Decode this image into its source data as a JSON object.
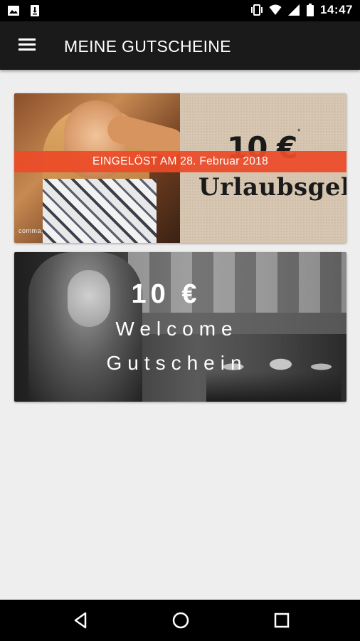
{
  "status_bar": {
    "time": "14:47",
    "left_icons": [
      "image-icon",
      "download-icon"
    ],
    "right_icons": [
      "vibrate-icon",
      "wifi-icon",
      "signal-icon",
      "battery-icon"
    ]
  },
  "app_bar": {
    "menu_icon": "menu-icon",
    "title": "MEINE GUTSCHEINE"
  },
  "vouchers": [
    {
      "amount": "10 €",
      "asterisk": "*",
      "name": "Urlaubsgeld",
      "brand": "comma,",
      "status": "EINGELÖST AM 28. Februar 2018",
      "status_color": "#ec4b28"
    },
    {
      "amount": "10 €",
      "line1": "Welcome",
      "line2": "Gutschein"
    }
  ],
  "nav_bar": {
    "buttons": [
      "back-icon",
      "home-icon",
      "recents-icon"
    ]
  },
  "colors": {
    "app_bar": "#1a1a1a",
    "background": "#eeeeee",
    "accent": "#ec4b28"
  }
}
